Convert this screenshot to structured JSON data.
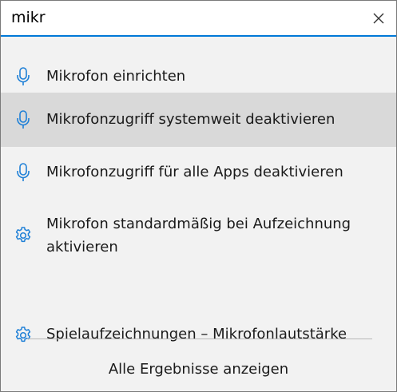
{
  "search": {
    "value": "mikr",
    "placeholder": ""
  },
  "results": [
    {
      "label": "Mikrofon einrichten",
      "icon": "microphone-icon",
      "selected": false
    },
    {
      "label": "Mikrofonzugriff systemweit deaktivieren",
      "icon": "microphone-icon",
      "selected": true
    },
    {
      "label": "Mikrofonzugriff für alle Apps deaktivieren",
      "icon": "microphone-icon",
      "selected": false
    },
    {
      "label": "Mikrofon standardmäßig bei Aufzeichnung aktivieren",
      "icon": "gear-icon",
      "selected": false
    },
    {
      "label": "Spielaufzeichnungen – Mikrofonlautstärke",
      "icon": "gear-icon",
      "selected": false
    }
  ],
  "footer": {
    "all_results_label": "Alle Ergebnisse anzeigen"
  },
  "colors": {
    "accent": "#0078d7",
    "background": "#f2f2f2",
    "selected_background": "#d9d9d9"
  }
}
